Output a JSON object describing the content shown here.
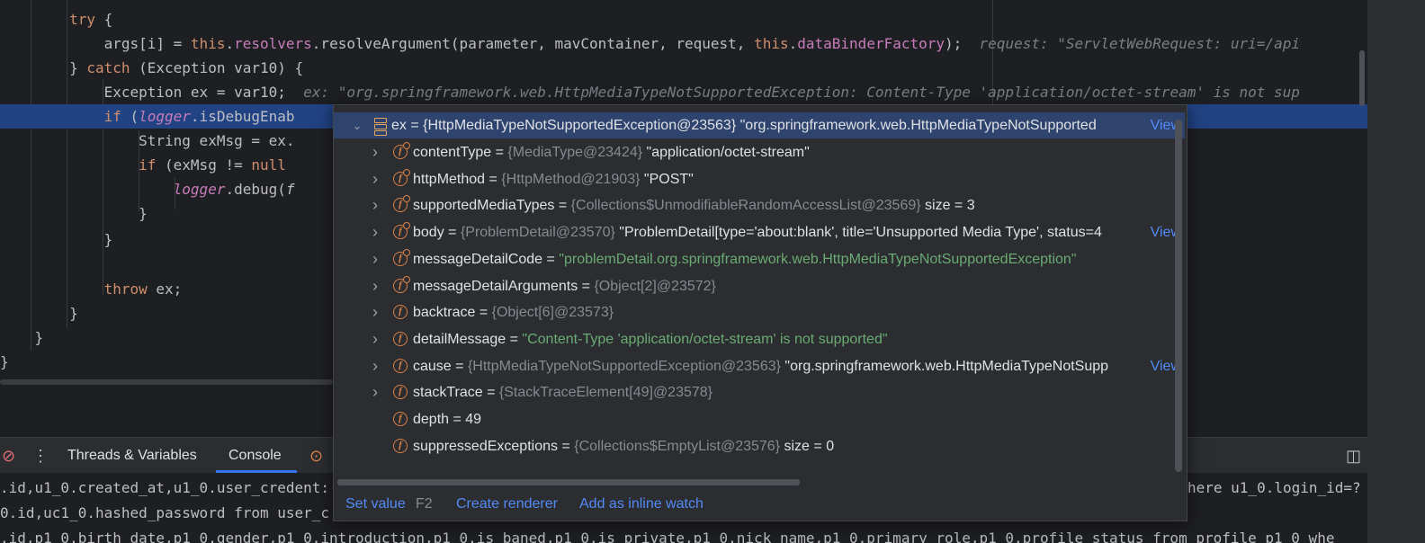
{
  "editor": {
    "lines": [
      {
        "id": "l1",
        "segments": [
          {
            "t": "        ",
            "c": ""
          },
          {
            "t": "try",
            "c": "kw"
          },
          {
            "t": " {",
            "c": ""
          }
        ]
      },
      {
        "id": "l2",
        "segments": [
          {
            "t": "            args[i] = ",
            "c": ""
          },
          {
            "t": "this",
            "c": "kw"
          },
          {
            "t": ".",
            "c": ""
          },
          {
            "t": "resolvers",
            "c": "fld"
          },
          {
            "t": ".resolveArgument(parameter, mavContainer, request, ",
            "c": ""
          },
          {
            "t": "this",
            "c": "kw"
          },
          {
            "t": ".",
            "c": ""
          },
          {
            "t": "dataBinderFactory",
            "c": "fld"
          },
          {
            "t": ");",
            "c": ""
          }
        ],
        "hint": "request: \"ServletWebRequest: uri=/api"
      },
      {
        "id": "l3",
        "segments": [
          {
            "t": "        } ",
            "c": ""
          },
          {
            "t": "catch",
            "c": "kw"
          },
          {
            "t": " (Exception var10) {",
            "c": ""
          }
        ]
      },
      {
        "id": "l4",
        "segments": [
          {
            "t": "            Exception ex = var10;",
            "c": ""
          }
        ],
        "hint": "ex: \"org.springframework.web.HttpMediaTypeNotSupportedException: Content-Type 'application/octet-stream' is not sup"
      },
      {
        "id": "l5",
        "segments": [
          {
            "t": "            ",
            "c": ""
          },
          {
            "t": "if",
            "c": "kw"
          },
          {
            "t": " (",
            "c": ""
          },
          {
            "t": "logger",
            "c": "fld it"
          },
          {
            "t": ".isDebugEnab",
            "c": ""
          }
        ],
        "highlight": true
      },
      {
        "id": "l6",
        "segments": [
          {
            "t": "                String exMsg = ex.",
            "c": ""
          }
        ]
      },
      {
        "id": "l7",
        "segments": [
          {
            "t": "                ",
            "c": ""
          },
          {
            "t": "if",
            "c": "kw"
          },
          {
            "t": " (exMsg != ",
            "c": ""
          },
          {
            "t": "null",
            "c": "kw"
          }
        ]
      },
      {
        "id": "l8",
        "segments": [
          {
            "t": "                    ",
            "c": ""
          },
          {
            "t": "logger",
            "c": "fld it"
          },
          {
            "t": ".debug(",
            "c": ""
          },
          {
            "t": "f",
            "c": "it"
          }
        ]
      },
      {
        "id": "l9",
        "segments": [
          {
            "t": "                }",
            "c": ""
          }
        ]
      },
      {
        "id": "l10",
        "segments": [
          {
            "t": "            }",
            "c": ""
          }
        ]
      },
      {
        "id": "l11",
        "segments": [
          {
            "t": "",
            "c": ""
          }
        ]
      },
      {
        "id": "l12",
        "segments": [
          {
            "t": "            ",
            "c": ""
          },
          {
            "t": "throw",
            "c": "kw"
          },
          {
            "t": " ex;",
            "c": ""
          }
        ]
      },
      {
        "id": "l13",
        "segments": [
          {
            "t": "        }",
            "c": ""
          }
        ]
      },
      {
        "id": "l14",
        "segments": [
          {
            "t": "    }",
            "c": ""
          }
        ]
      },
      {
        "id": "l15",
        "segments": [
          {
            "t": "}",
            "c": ""
          }
        ]
      }
    ]
  },
  "toolbar": {
    "tab_threads": "Threads & Variables",
    "tab_console": "Console"
  },
  "console": {
    "lines": [
      ".id,u1_0.created_at,u1_0.user_credent:",
      "0.id,uc1_0.hashed_password from user_c",
      ".id,p1_0.birth_date,p1_0.gender,p1_0.introduction,p1_0.is_baned,p1_0.is_private,p1_0.nick_name,p1_0.primary_role,p1_0.profile_status from profile p1_0 whe"
    ],
    "right_fragment": "here u1_0.login_id=?"
  },
  "popup": {
    "root": {
      "name": "ex",
      "eq": " = ",
      "type": "{HttpMediaTypeNotSupportedException@23563}",
      "value": " \"org.springframework.web.HttpMediaTypeNotSupported",
      "view": "View"
    },
    "rows": [
      {
        "name": "contentType",
        "type": "{MediaType@23424}",
        "value": "\"application/octet-stream\"",
        "kind": "val",
        "icon": "field-locked",
        "expand": true
      },
      {
        "name": "httpMethod",
        "type": "{HttpMethod@21903}",
        "value": "\"POST\"",
        "kind": "val",
        "icon": "field-locked",
        "expand": true
      },
      {
        "name": "supportedMediaTypes",
        "type": "{Collections$UnmodifiableRandomAccessList@23569}",
        "value": " size = 3",
        "kind": "val",
        "icon": "field-locked",
        "expand": true
      },
      {
        "name": "body",
        "type": "{ProblemDetail@23570}",
        "value": "\"ProblemDetail[type='about:blank', title='Unsupported Media Type', status=4",
        "kind": "val",
        "icon": "field-locked",
        "expand": true,
        "view": "View"
      },
      {
        "name": "messageDetailCode",
        "type": "",
        "value": "\"problemDetail.org.springframework.web.HttpMediaTypeNotSupportedException\"",
        "kind": "str",
        "icon": "field-locked",
        "expand": true
      },
      {
        "name": "messageDetailArguments",
        "type": "{Object[2]@23572}",
        "value": "",
        "kind": "val",
        "icon": "field-locked",
        "expand": true
      },
      {
        "name": "backtrace",
        "type": "{Object[6]@23573}",
        "value": "",
        "kind": "val",
        "icon": "field",
        "expand": true
      },
      {
        "name": "detailMessage",
        "type": "",
        "value": "\"Content-Type 'application/octet-stream' is not supported\"",
        "kind": "str",
        "icon": "field",
        "expand": true
      },
      {
        "name": "cause",
        "type": "{HttpMediaTypeNotSupportedException@23563}",
        "value": "\"org.springframework.web.HttpMediaTypeNotSupp",
        "kind": "val",
        "icon": "field-arrow",
        "expand": true,
        "view": "View"
      },
      {
        "name": "stackTrace",
        "type": "{StackTraceElement[49]@23578}",
        "value": "",
        "kind": "val",
        "icon": "field",
        "expand": true
      },
      {
        "name": "depth",
        "type": "",
        "value": "49",
        "kind": "val",
        "icon": "field",
        "expand": false
      },
      {
        "name": "suppressedExceptions",
        "type": "{Collections$EmptyList@23576}",
        "value": " size = 0",
        "kind": "val",
        "icon": "field",
        "expand": false
      }
    ],
    "footer": {
      "set_value": "Set value",
      "set_value_key": "F2",
      "create_renderer": "Create renderer",
      "inline_watch": "Add as inline watch"
    }
  }
}
